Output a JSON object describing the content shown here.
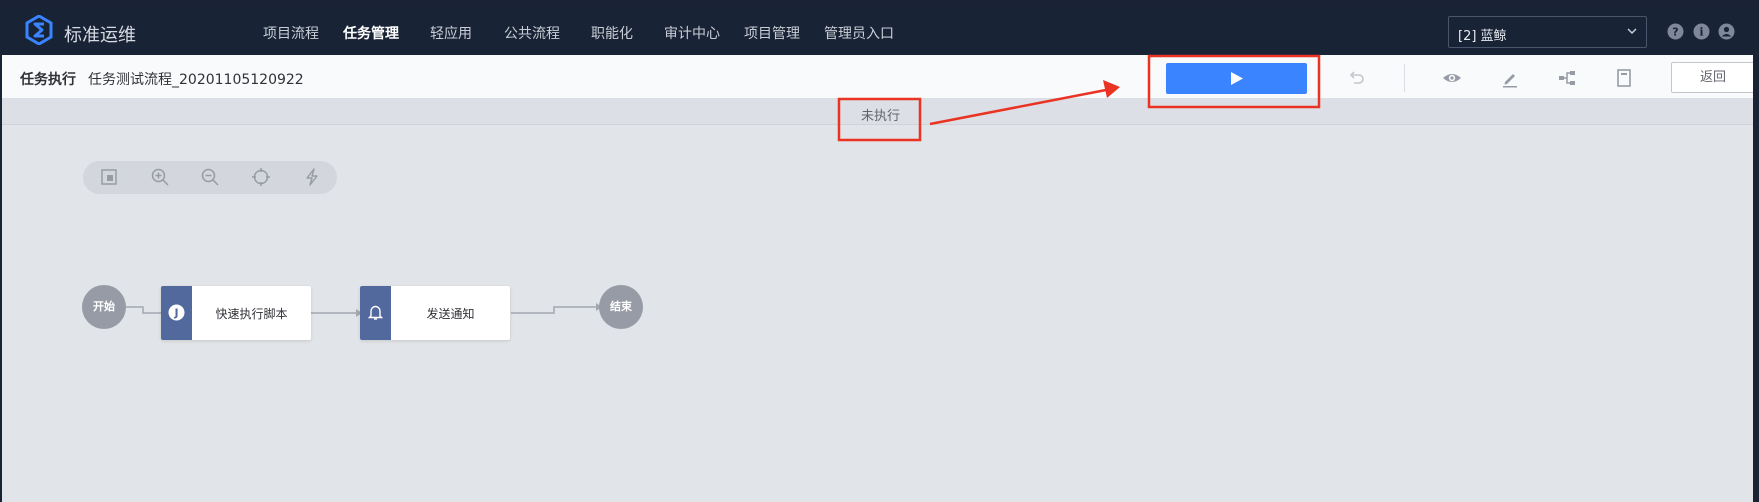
{
  "header": {
    "brand": "标准运维",
    "nav": [
      "项目流程",
      "任务管理",
      "轻应用",
      "公共流程",
      "职能化",
      "审计中心",
      "项目管理",
      "管理员入口"
    ],
    "active_index": 1,
    "business_select": "[2] 蓝鲸",
    "icons": [
      "help-icon",
      "info-icon",
      "user-icon"
    ]
  },
  "subheader": {
    "title": "任务执行",
    "task_name": "任务测试流程_20201105120922",
    "back_label": "返回",
    "toolbar_icons": [
      "play-icon",
      "revoke-icon",
      "view-icon",
      "edit-icon",
      "node-tree-icon",
      "document-icon"
    ]
  },
  "status": {
    "text": "未执行"
  },
  "canvas": {
    "tools": [
      "select-icon",
      "zoom-in-icon",
      "zoom-out-icon",
      "reset-position-icon",
      "lightning-icon"
    ],
    "flow": {
      "start": "开始",
      "nodes": [
        {
          "label": "快速执行脚本",
          "icon": "job-j-icon"
        },
        {
          "label": "发送通知",
          "icon": "bell-icon"
        }
      ],
      "end": "结束"
    }
  },
  "colors": {
    "accent": "#3a84ff",
    "annotation": "#ea3323",
    "header": "#182335",
    "node_side": "#52699d"
  }
}
